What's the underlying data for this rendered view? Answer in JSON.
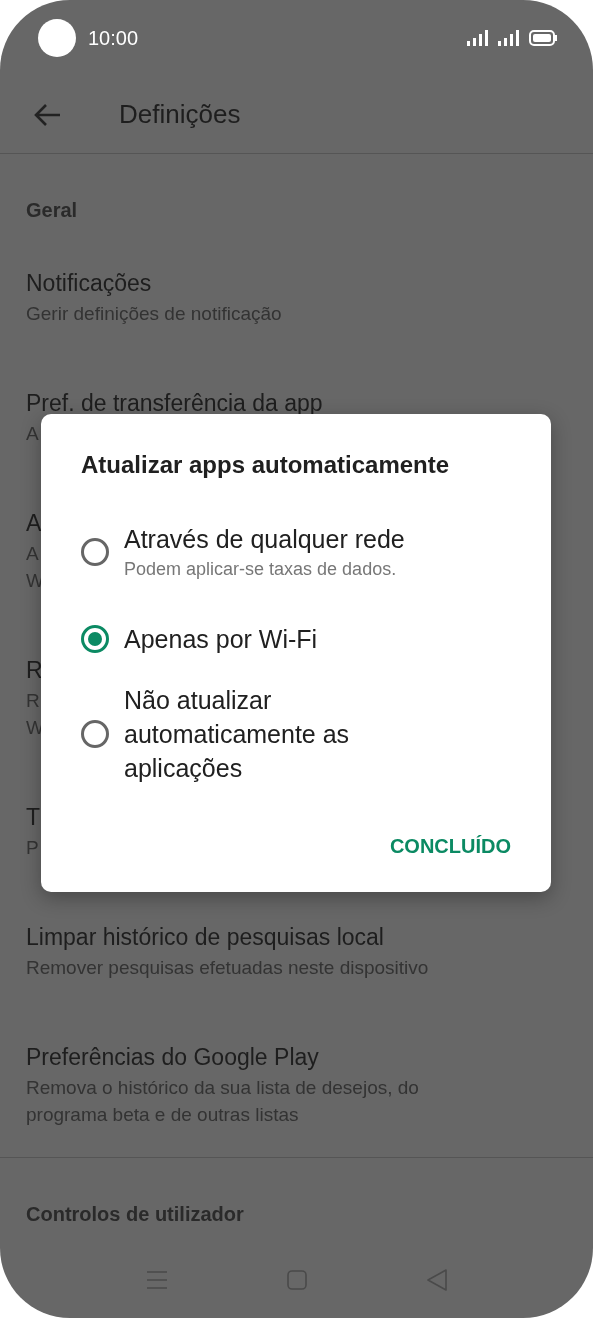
{
  "status_bar": {
    "time": "10:00"
  },
  "app_bar": {
    "title": "Definições"
  },
  "sections": [
    {
      "header": "Geral",
      "items": [
        {
          "title": "Notificações",
          "subtitle": [
            "Gerir definições de notificação"
          ]
        },
        {
          "title": "Pref. de transferência da app",
          "subtitle": [
            "A"
          ]
        },
        {
          "title": "A",
          "subtitle": [
            "A",
            "W"
          ]
        },
        {
          "title": "R",
          "subtitle": [
            "R",
            "W"
          ]
        },
        {
          "title": "T",
          "subtitle": [
            "P"
          ]
        },
        {
          "title": "Limpar histórico de pesquisas local",
          "subtitle": [
            "Remover pesquisas efetuadas neste dispositivo"
          ]
        },
        {
          "title": "Preferências do Google Play",
          "subtitle": [
            "Remova o histórico da sua lista de desejos, do",
            "programa beta e de outras listas"
          ]
        }
      ]
    },
    {
      "header": "Controlos de utilizador"
    }
  ],
  "dialog": {
    "title": "Atualizar apps automaticamente",
    "options": [
      {
        "label": "Através de qualquer rede",
        "hint": "Podem aplicar-se taxas de dados.",
        "selected": false
      },
      {
        "label": "Apenas por Wi-Fi",
        "selected": true
      },
      {
        "label": "Não atualizar automaticamente as aplicações",
        "selected": false
      }
    ],
    "button": "CONCLUÍDO"
  }
}
